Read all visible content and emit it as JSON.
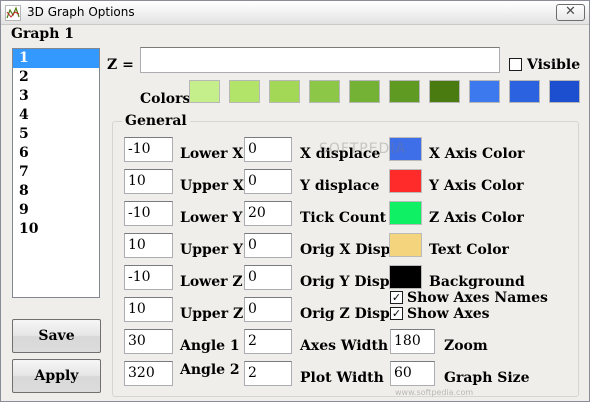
{
  "window": {
    "title": "3D Graph Options",
    "close_glyph": "✕"
  },
  "graph_label": "Graph 1",
  "graph_list": [
    "1",
    "2",
    "3",
    "4",
    "5",
    "6",
    "7",
    "8",
    "9",
    "10"
  ],
  "selected_graph": "1",
  "buttons": {
    "save": "Save",
    "apply": "Apply"
  },
  "z_label": "Z =",
  "z_value": "",
  "visible": {
    "label": "Visible",
    "checked": false
  },
  "colors_label": "Colors",
  "color_swatches": [
    "#c5ef8a",
    "#b2e46a",
    "#a2d855",
    "#8cc747",
    "#73b234",
    "#5f9a22",
    "#4a7b10",
    "#3c78ee",
    "#2a62e0",
    "#1c4ed0"
  ],
  "general": {
    "title": "General",
    "lower_x": {
      "label": "Lower X",
      "value": "-10"
    },
    "upper_x": {
      "label": "Upper X",
      "value": "10"
    },
    "lower_y": {
      "label": "Lower Y",
      "value": "-10"
    },
    "upper_y": {
      "label": "Upper Y",
      "value": "10"
    },
    "lower_z": {
      "label": "Lower Z",
      "value": "-10"
    },
    "upper_z": {
      "label": "Upper Z",
      "value": "10"
    },
    "angle_1": {
      "label": "Angle 1",
      "value": "30"
    },
    "angle_2": {
      "label": "Angle 2",
      "value": "320"
    },
    "x_displace": {
      "label": "X displace",
      "value": "0"
    },
    "y_displace": {
      "label": "Y displace",
      "value": "0"
    },
    "tick_count": {
      "label": "Tick Count",
      "value": "20"
    },
    "orig_x_disp": {
      "label": "Orig X Disp",
      "value": "0"
    },
    "orig_y_disp": {
      "label": "Orig Y Disp",
      "value": "0"
    },
    "orig_z_disp": {
      "label": "Orig Z Disp",
      "value": "0"
    },
    "axes_width": {
      "label": "Axes Width",
      "value": "2"
    },
    "plot_width": {
      "label": "Plot Width",
      "value": "2"
    },
    "x_axis_color": {
      "label": "X Axis Color",
      "color": "#3f6fe8"
    },
    "y_axis_color": {
      "label": "Y Axis Color",
      "color": "#ff2a2a"
    },
    "z_axis_color": {
      "label": "Z Axis Color",
      "color": "#0ff064"
    },
    "text_color": {
      "label": "Text Color",
      "color": "#f5d47e"
    },
    "background": {
      "label": "Background",
      "color": "#000000"
    },
    "show_axes_names": {
      "label": "Show Axes Names",
      "checked": true
    },
    "show_axes": {
      "label": "Show Axes",
      "checked": true
    },
    "zoom": {
      "label": "Zoom",
      "value": "180"
    },
    "graph_size": {
      "label": "Graph Size",
      "value": "60"
    }
  },
  "watermark": "SOFTPEDIA",
  "footer_watermark": "www.softpedia.com"
}
